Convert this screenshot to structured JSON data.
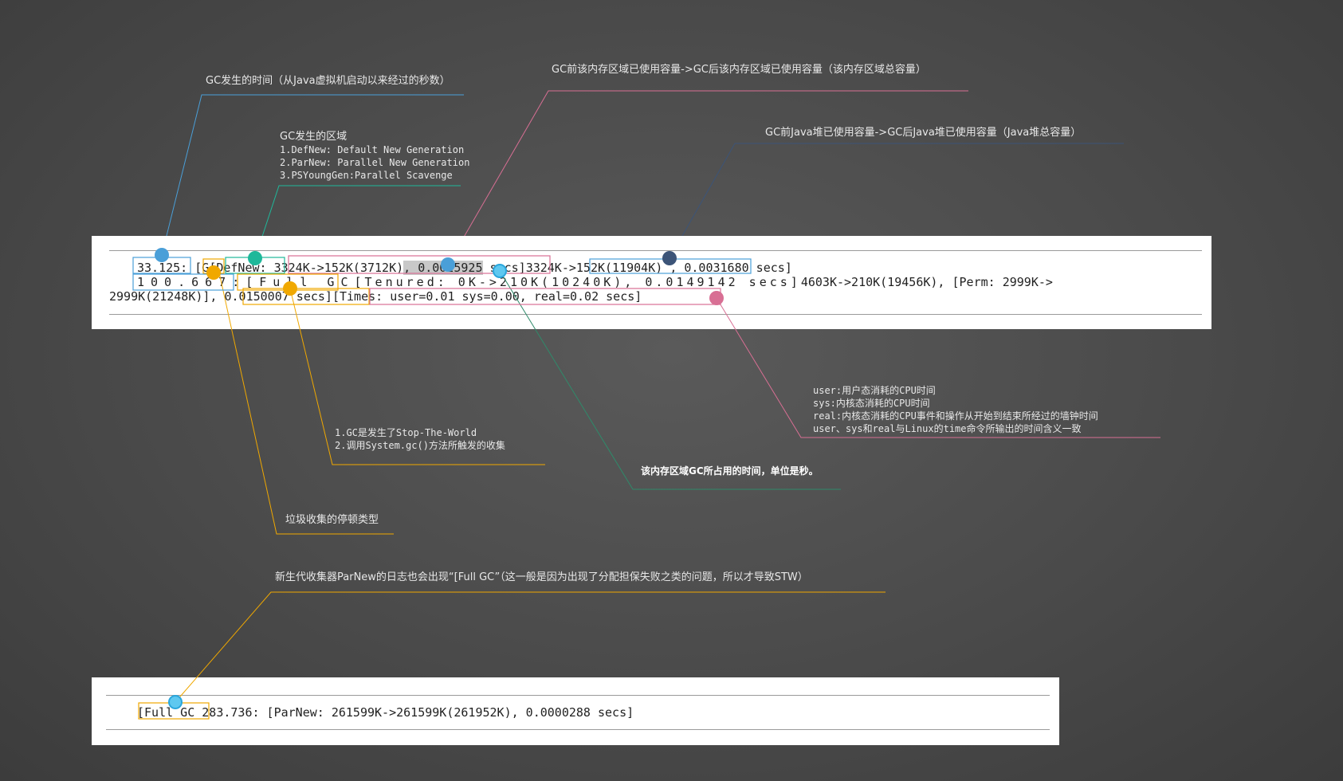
{
  "colors": {
    "blue": "#4a9fd8",
    "teal": "#1fb89a",
    "pink": "#d86f94",
    "navy": "#3c5478",
    "orange": "#f0a800",
    "green": "#2f8a6a",
    "background": "#4a4a4a"
  },
  "log_lines": {
    "line1": {
      "timestamp": "33.125:",
      "gc_type": "[G",
      "young_area": "[DefNew:",
      "young_usage": "3324K->152K(3712K)",
      "young_time": ", 0.0025925",
      "young_time_tail": "secs]",
      "heap_usage": "3324K->152K(11904K)",
      "rest": ", 0.0031680 secs]"
    },
    "line2": {
      "timestamp": "100.667:",
      "gc_type": "[Full GC",
      "old_area": "[Tenured: 0K->210K(10240K), 0.0149142 secs]",
      "rest": "4603K->210K(19456K), [Perm: 2999K->"
    },
    "line3": {
      "perm": "2999K(21248K)],",
      "time": "0.0150007 secs]",
      "times": "[Times: user=0.01 sys=0.00, real=0.02 secs]"
    },
    "bottom": {
      "full_gc": "[Full GC",
      "rest": "283.736: [ParNew: 261599K->261599K(261952K), 0.0000288 secs]"
    }
  },
  "annotations": {
    "gc_time": "GC发生的时间（从Java虚拟机启动以来经过的秒数）",
    "gc_area": {
      "title": "GC发生的区域",
      "items": [
        "1.DefNew: Default New Generation",
        "2.ParNew: Parallel New Generation",
        "3.PSYoungGen:Parallel Scavenge"
      ]
    },
    "region_usage": "GC前该内存区域已使用容量->GC后该内存区域已使用容量（该内存区域总容量）",
    "heap_usage": "GC前Java堆已使用容量->GC后Java堆已使用容量（Java堆总容量）",
    "times": [
      "user:用户态消耗的CPU时间",
      "sys:内核态消耗的CPU时间",
      "real:内核态消耗的CPU事件和操作从开始到结束所经过的墙钟时间",
      "user、sys和real与Linux的time命令所输出的时间含义一致"
    ],
    "full_gc_reason": [
      "1.GC是发生了Stop-The-World",
      "2.调用System.gc()方法所触发的收集"
    ],
    "region_time": "该内存区域GC所占用的时间，单位是秒。",
    "pause_type": "垃圾收集的停顿类型",
    "parnew_full_gc": "新生代收集器ParNew的日志也会出现“[Full GC”（这一般是因为出现了分配担保失败之类的问题，所以才导致STW）"
  }
}
